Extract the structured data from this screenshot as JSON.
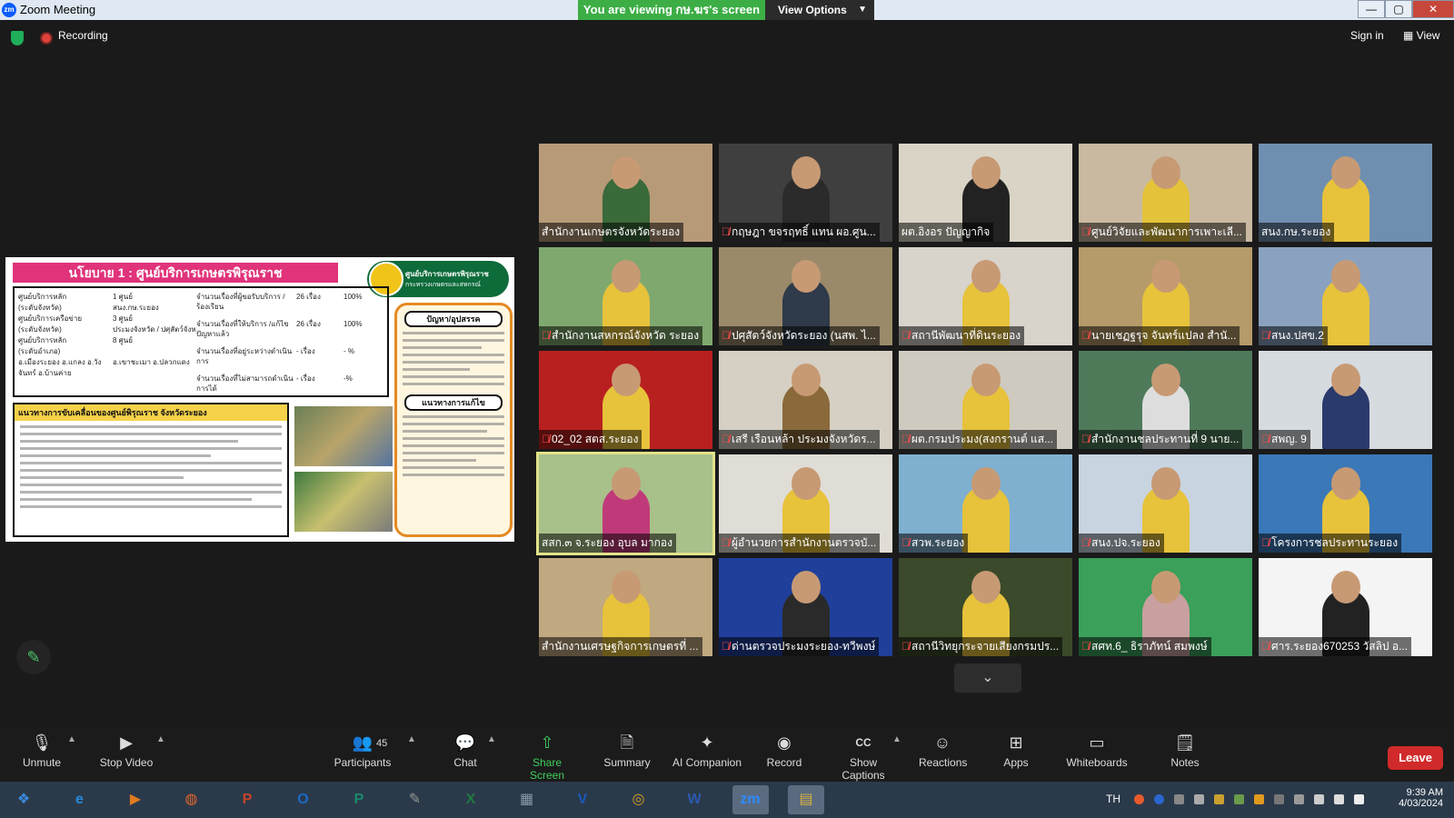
{
  "window": {
    "title": "Zoom Meeting",
    "viewing_banner": "You are viewing กษ.ฆร's screen",
    "view_options": "View Options",
    "min": "—",
    "max": "▢",
    "close": "✕"
  },
  "status": {
    "recording": "Recording",
    "sign_in": "Sign in",
    "view": "View"
  },
  "slide": {
    "title": "นโยบาย 1 : ศูนย์บริการเกษตรพิรุณราช",
    "logo_text": "ศูนย์บริการเกษตรพิรุณราช",
    "logo_sub": "กระทรวงเกษตรและสหกรณ์",
    "rows": [
      {
        "label": "ศูนย์บริการหลัก",
        "value": "1 ศูนย์"
      },
      {
        "label": "(ระดับจังหวัด)",
        "value": "สนง.กษ.ระยอง"
      },
      {
        "label": "ศูนย์บริการเครือข่าย",
        "value": "3 ศูนย์"
      },
      {
        "label": "(ระดับจังหวัด)",
        "value": "ประมงจังหวัด / ปศุสัตว์จังหวัด / ส.ป.ก."
      },
      {
        "label": "ศูนย์บริการหลัก",
        "value": "8 ศูนย์"
      },
      {
        "label": "(ระดับอำเภอ)",
        "value": ""
      },
      {
        "label": "อ.เมืองระยอง  อ.แกลง  อ.วังจันทร์  อ.บ้านค่าย",
        "value": "อ.เขาชะเมา  อ.ปลวกแดง"
      }
    ],
    "stats": [
      {
        "label": "จำนวนเรื่องที่ผู้ขอรับบริการ /ร้องเรียน",
        "count": "26 เรื่อง",
        "pct": "100%"
      },
      {
        "label": "จำนวนเรื่องที่ให้บริการ /แก้ไขปัญหาแล้ว",
        "count": "26 เรื่อง",
        "pct": "100%"
      },
      {
        "label": "จำนวนเรื่องที่อยู่ระหว่างดำเนินการ",
        "count": "- เรื่อง",
        "pct": "- %"
      },
      {
        "label": "จำนวนเรื่องที่ไม่สามารถดำเนินการได้",
        "count": "- เรื่อง",
        "pct": "-%"
      }
    ],
    "panel_title": "แนวทางการขับเคลื่อนของศูนย์พิรุณราช จังหวัดระยอง",
    "side_tag1": "ปัญหา/อุปสรรค",
    "side_tag2": "แนวทางการแก้ไข"
  },
  "participants": [
    {
      "name": "สำนักงานเกษตรจังหวัดระยอง",
      "muted": false,
      "bg": "#b79a78",
      "shirt": "#3a6a3a"
    },
    {
      "name": "กฤษฎา ขจรฤทธิ์ แทน ผอ.ศูน...",
      "muted": true,
      "bg": "#3f3f3f",
      "shirt": "#2b2b2b"
    },
    {
      "name": "ผต.อิงอร ปัญญากิจ",
      "muted": false,
      "bg": "#d9d4c6",
      "shirt": "#222"
    },
    {
      "name": "ศูนย์วิจัยและพัฒนาการเพาะเลี...",
      "muted": true,
      "bg": "#c9b9a0",
      "shirt": "#e4c23a"
    },
    {
      "name": "สนง.กษ.ระยอง",
      "muted": false,
      "bg": "#6f8fb0",
      "shirt": "#e7c23b"
    },
    {
      "name": "สำนักงานสหกรณ์จังหวัด ระยอง",
      "muted": true,
      "bg": "#7fa86e",
      "shirt": "#e7c23b"
    },
    {
      "name": "ปศุสัตว์จังหวัดระยอง (นสพ. ไ...",
      "muted": true,
      "bg": "#9a8a6a",
      "shirt": "#2f3a4a"
    },
    {
      "name": "สถานีพัฒนาที่ดินระยอง",
      "muted": true,
      "bg": "#d8d3cb",
      "shirt": "#e7c23b"
    },
    {
      "name": "นายเชฏฐรุจ จันทร์แปลง สำนั...",
      "muted": true,
      "bg": "#b59a6a",
      "shirt": "#e7c23b"
    },
    {
      "name": "สนง.ปสข.2",
      "muted": true,
      "bg": "#8aa2c0",
      "shirt": "#e7c23b"
    },
    {
      "name": "02_02 สตส.ระยอง",
      "muted": true,
      "bg": "#b82020",
      "shirt": "#e7c23b"
    },
    {
      "name": "เสรี เรือนหล้า ประมงจังหวัดร...",
      "muted": true,
      "bg": "#d6d0c4",
      "shirt": "#8a6a3a"
    },
    {
      "name": "ผต.กรมประมง(สงกรานต์ แส...",
      "muted": true,
      "bg": "#cfcac0",
      "shirt": "#e7c23b"
    },
    {
      "name": "สำนักงานชลประทานที่ 9 นาย...",
      "muted": true,
      "bg": "#4e7a5a",
      "shirt": "#ddd"
    },
    {
      "name": "สพญ. 9",
      "muted": true,
      "bg": "#d6dbe0",
      "shirt": "#2a3a6a"
    },
    {
      "name": "สสก.๓ จ.ระยอง อุบล มากอง",
      "muted": false,
      "bg": "#a8c08a",
      "shirt": "#c03a7a",
      "active": true
    },
    {
      "name": "ผู้อำนวยการสำนักงานตรวจบั...",
      "muted": true,
      "bg": "#e0ddd6",
      "shirt": "#e7c23b"
    },
    {
      "name": "สวพ.ระยอง",
      "muted": true,
      "bg": "#7fb0d0",
      "shirt": "#e7c23b"
    },
    {
      "name": "สนง.ปจ.ระยอง",
      "muted": true,
      "bg": "#c8d4e0",
      "shirt": "#e7c23b"
    },
    {
      "name": "โครงการชลประทานระยอง",
      "muted": true,
      "bg": "#3b78b8",
      "shirt": "#e7c23b"
    },
    {
      "name": "สำนักงานเศรษฐกิจการเกษตรที่ ...",
      "muted": false,
      "bg": "#c0a880",
      "shirt": "#e7c23b"
    },
    {
      "name": "ด่านตรวจประมงระยอง-ทวีพงษ์",
      "muted": true,
      "bg": "#1f3f9a",
      "shirt": "#2a2a2a"
    },
    {
      "name": "สถานีวิทยุกระจายเสียงกรมปร...",
      "muted": true,
      "bg": "#3a4a2a",
      "shirt": "#e7c23b"
    },
    {
      "name": "สศท.6_ ธิราภัทน์ สมพงษ์",
      "muted": true,
      "bg": "#3aa05a",
      "shirt": "#c9a0a0"
    },
    {
      "name": "ศาร.ระยอง670253 วัสลิป อ...",
      "muted": true,
      "bg": "#f4f4f4",
      "shirt": "#222"
    }
  ],
  "toolbar": {
    "unmute": "Unmute",
    "stop_video": "Stop Video",
    "participants": "Participants",
    "participants_count": "45",
    "chat": "Chat",
    "share_screen": "Share Screen",
    "summary": "Summary",
    "ai_companion": "AI Companion",
    "record": "Record",
    "captions": "Show Captions",
    "reactions": "Reactions",
    "apps": "Apps",
    "whiteboards": "Whiteboards",
    "notes": "Notes",
    "leave": "Leave"
  },
  "taskbar": {
    "apps": [
      "start-orb-icon",
      "ie-icon",
      "media-icon",
      "firefox-icon",
      "powerpoint-icon",
      "outlook-icon",
      "publisher-icon",
      "paint-icon",
      "excel-icon",
      "calculator-icon",
      "v-icon",
      "chrome-icon",
      "word-icon",
      "zoom-icon",
      "explorer-icon"
    ],
    "lang": "TH",
    "time": "9:39 AM",
    "date": "4/03/2024"
  }
}
